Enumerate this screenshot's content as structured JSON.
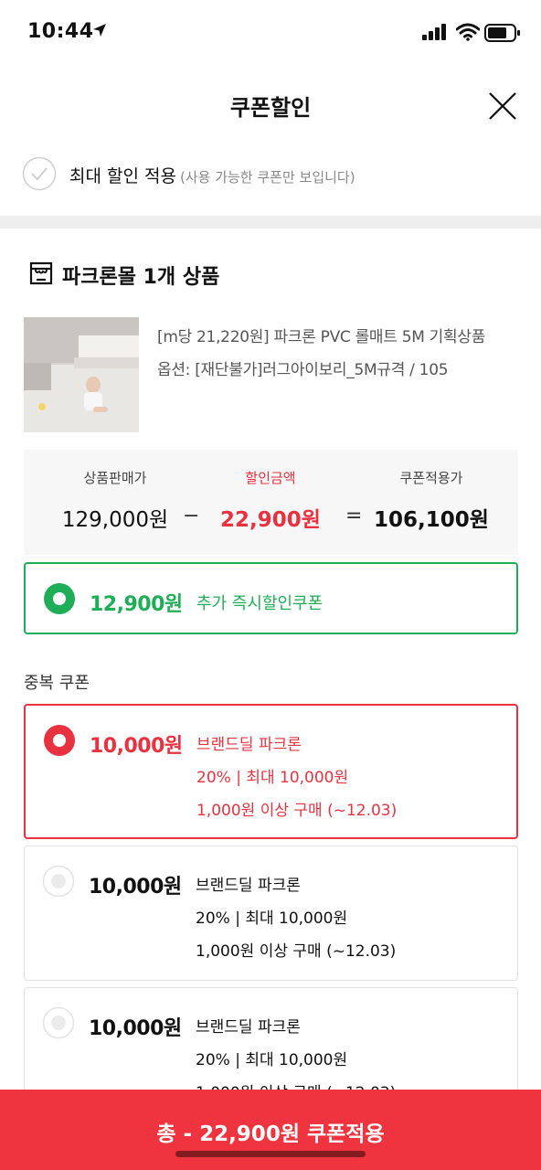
{
  "status_bar": {
    "time": "10:44"
  },
  "header": {
    "title": "쿠폰할인"
  },
  "max_discount": {
    "label": "최대 할인 적용",
    "sub_label": "(사용 가능한 쿠폰만 보입니다)"
  },
  "store": {
    "name": "파크론몰 1개 상품"
  },
  "product": {
    "title": "[m당 21,220원] 파크론 PVC 롤매트 5M 기획상품",
    "option": "옵션: [재단불가]러그아이보리_5M규격 / 105"
  },
  "price_summary": {
    "sale_label": "상품판매가",
    "sale_value": "129,000원",
    "minus": "−",
    "discount_label": "할인금액",
    "discount_value": "22,900원",
    "equals": "=",
    "final_label": "쿠폰적용가",
    "final_value": "106,100원"
  },
  "instant_coupon": {
    "amount": "12,900원",
    "name": "추가 즉시할인쿠폰"
  },
  "duplicate_coupons": {
    "section_label": "중복 쿠폰",
    "items": [
      {
        "amount": "10,000원",
        "name": "브랜드딜 파크론",
        "detail": "20% | 최대 10,000원",
        "condition": "1,000원 이상 구매 (~12.03)",
        "selected": true
      },
      {
        "amount": "10,000원",
        "name": "브랜드딜 파크론",
        "detail": "20% | 최대 10,000원",
        "condition": "1,000원 이상 구매 (~12.03)",
        "selected": false
      },
      {
        "amount": "10,000원",
        "name": "브랜드딜 파크론",
        "detail": "20% | 최대 10,000원",
        "condition": "1,000원 이상 구매 (~12.03)",
        "selected": false
      }
    ]
  },
  "apply_button": {
    "label": "총 - 22,900원 쿠폰적용"
  },
  "colors": {
    "accent_red": "#e8323f",
    "accent_green": "#1fae57",
    "button_red": "#f0343f"
  }
}
